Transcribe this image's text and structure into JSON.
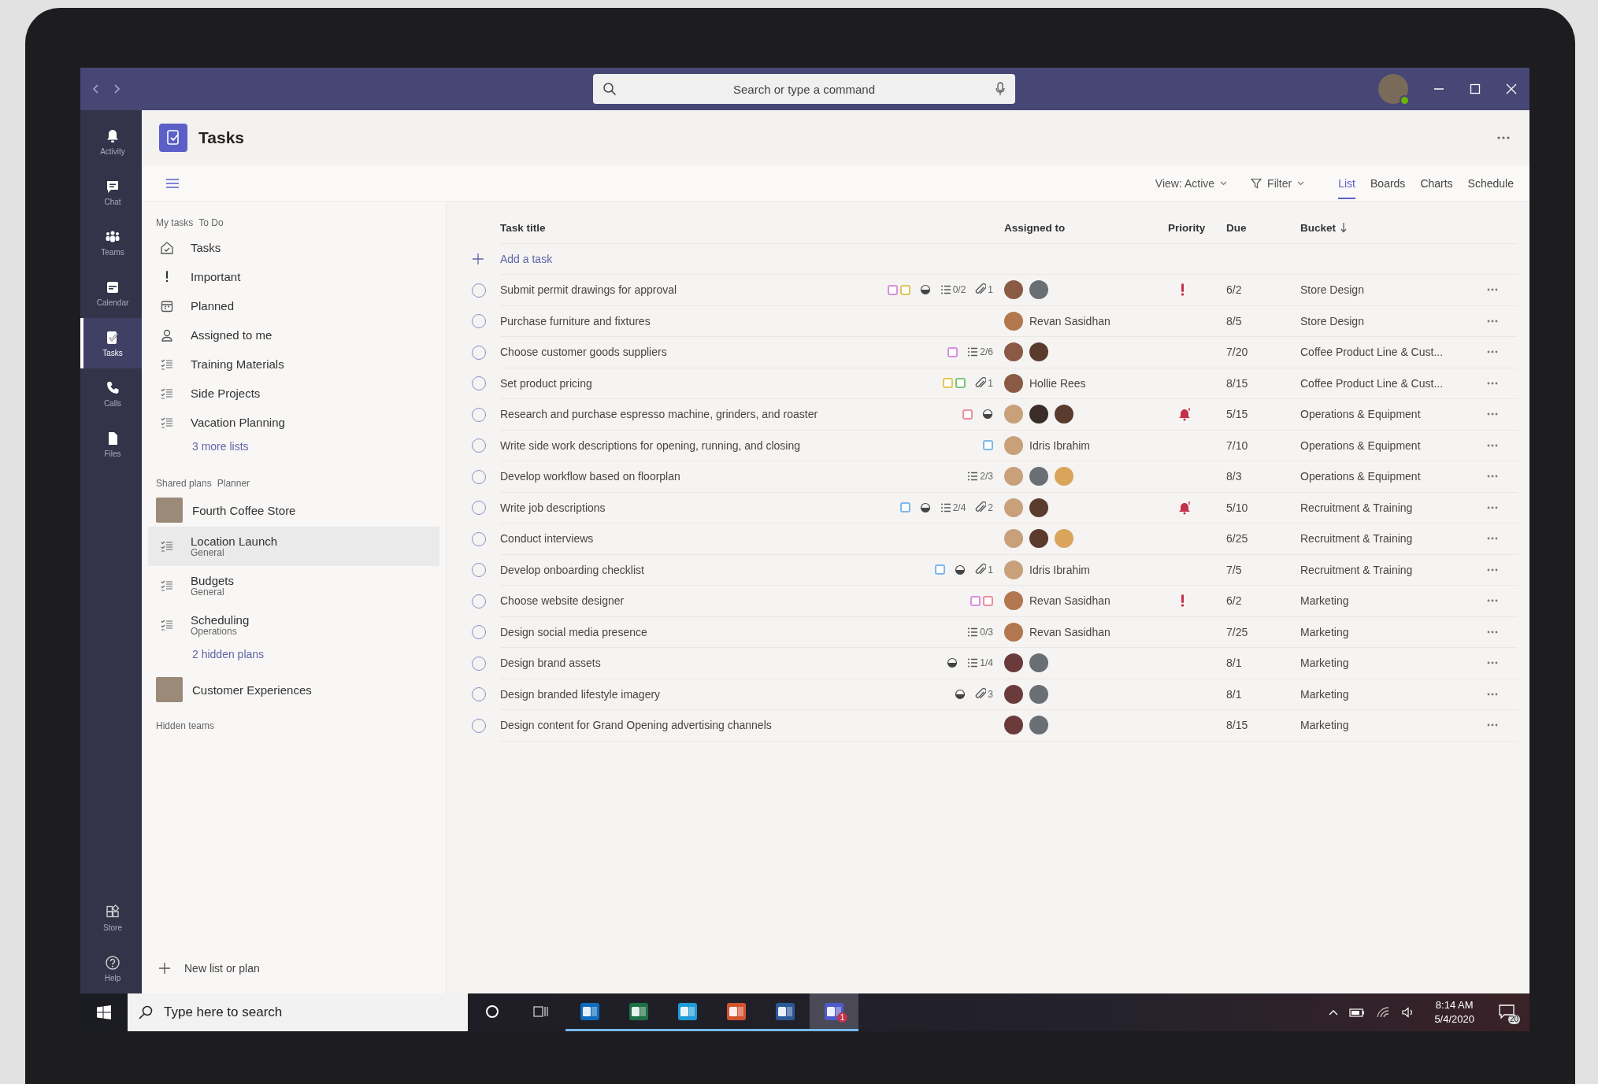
{
  "titlebar": {
    "search_placeholder": "Search or type a command"
  },
  "rail": {
    "items": [
      {
        "label": "Activity",
        "kind": "bell",
        "selected": false
      },
      {
        "label": "Chat",
        "kind": "chat",
        "selected": false
      },
      {
        "label": "Teams",
        "kind": "teams",
        "selected": false
      },
      {
        "label": "Calendar",
        "kind": "calendar",
        "selected": false
      },
      {
        "label": "Tasks",
        "kind": "tasks",
        "selected": true
      },
      {
        "label": "Calls",
        "kind": "calls",
        "selected": false
      },
      {
        "label": "Files",
        "kind": "files",
        "selected": false
      }
    ],
    "bottom_items": [
      {
        "label": "Store",
        "kind": "store",
        "selected": false
      },
      {
        "label": "Help",
        "kind": "help",
        "selected": false
      }
    ]
  },
  "app": {
    "title": "Tasks"
  },
  "toolbar": {
    "view": "View: Active",
    "filter": "Filter",
    "tabs": [
      {
        "label": "List",
        "selected": true
      },
      {
        "label": "Boards",
        "selected": false
      },
      {
        "label": "Charts",
        "selected": false
      },
      {
        "label": "Schedule",
        "selected": false
      }
    ]
  },
  "nav": {
    "my_tasks": {
      "heading": "My tasks",
      "source": "To Do",
      "items": [
        {
          "label": "Tasks",
          "kind": "home"
        },
        {
          "label": "Important",
          "kind": "important"
        },
        {
          "label": "Planned",
          "kind": "calendar"
        },
        {
          "label": "Assigned to me",
          "kind": "person"
        },
        {
          "label": "Training Materials",
          "kind": "list"
        },
        {
          "label": "Side Projects",
          "kind": "list"
        },
        {
          "label": "Vacation Planning",
          "kind": "list"
        }
      ],
      "more": "3 more lists"
    },
    "shared": {
      "heading": "Shared plans",
      "source": "Planner",
      "teams": [
        {
          "name": "Fourth Coffee Store",
          "children": [
            {
              "name": "Location Launch",
              "channel": "General",
              "selected": true
            },
            {
              "name": "Budgets",
              "channel": "General",
              "selected": false
            },
            {
              "name": "Scheduling",
              "channel": "Operations",
              "selected": false
            }
          ],
          "more": "2 hidden plans"
        },
        {
          "name": "Customer Experiences"
        }
      ]
    },
    "hidden_teams": "Hidden teams",
    "new": "New list or plan"
  },
  "table": {
    "columns": [
      {
        "label": "Task title",
        "sorted": false
      },
      {
        "label": "Assigned to",
        "sorted": false
      },
      {
        "label": "Priority",
        "sorted": false
      },
      {
        "label": "Due",
        "sorted": false
      },
      {
        "label": "Bucket",
        "sorted": true
      }
    ],
    "add": "Add a task",
    "rows": [
      {
        "title": "Submit permit drawings for approval",
        "completed": false,
        "labels": [
          {
            "color": "#d98fe0"
          },
          {
            "color": "#e2c65a"
          }
        ],
        "in_progress": true,
        "checklist": "0/2",
        "attachments": "1",
        "assignees": [
          {
            "color": "#8a5a44"
          },
          {
            "color": "#6a6e75"
          }
        ],
        "important": true,
        "urgent": false,
        "due": "6/2",
        "bucket": "Store Design"
      },
      {
        "title": "Purchase furniture and fixtures",
        "completed": false,
        "in_progress": false,
        "important": false,
        "urgent": false,
        "assignees": [
          {
            "color": "#b3774f"
          }
        ],
        "assignee_name": "Revan Sasidhan",
        "due": "8/5",
        "bucket": "Store Design"
      },
      {
        "title": "Choose customer goods suppliers",
        "completed": false,
        "in_progress": false,
        "important": false,
        "urgent": false,
        "labels": [
          {
            "color": "#d98fe0"
          }
        ],
        "checklist": "2/6",
        "assignees": [
          {
            "color": "#8a5a44"
          },
          {
            "color": "#5a3b2e"
          }
        ],
        "due": "7/20",
        "bucket": "Coffee Product Line & Cust..."
      },
      {
        "title": "Set product pricing",
        "completed": false,
        "in_progress": false,
        "important": false,
        "urgent": false,
        "labels": [
          {
            "color": "#e2c65a"
          },
          {
            "color": "#7cc47c"
          }
        ],
        "attachments": "1",
        "assignees": [
          {
            "color": "#8a5a44"
          }
        ],
        "assignee_name": "Hollie Rees",
        "due": "8/15",
        "bucket": "Coffee Product Line & Cust..."
      },
      {
        "title": "Research and purchase espresso machine, grinders, and roaster",
        "completed": false,
        "labels": [
          {
            "color": "#ee8f9c"
          }
        ],
        "in_progress": true,
        "assignees": [
          {
            "color": "#c8a07a"
          },
          {
            "color": "#3a2c28"
          },
          {
            "color": "#5a3b2e"
          }
        ],
        "important": false,
        "urgent": true,
        "due": "5/15",
        "bucket": "Operations & Equipment"
      },
      {
        "title": "Write side work descriptions for opening, running, and closing",
        "completed": false,
        "in_progress": false,
        "important": false,
        "urgent": false,
        "labels": [
          {
            "color": "#7fb8ea"
          }
        ],
        "assignees": [
          {
            "color": "#c8a07a"
          }
        ],
        "assignee_name": "Idris Ibrahim",
        "due": "7/10",
        "bucket": "Operations & Equipment"
      },
      {
        "title": "Develop workflow based on floorplan",
        "completed": false,
        "in_progress": false,
        "important": false,
        "urgent": false,
        "checklist": "2/3",
        "assignees": [
          {
            "color": "#c8a07a"
          },
          {
            "color": "#6a6e75"
          },
          {
            "color": "#d9a55c"
          }
        ],
        "due": "8/3",
        "bucket": "Operations & Equipment"
      },
      {
        "title": "Write job descriptions",
        "completed": false,
        "labels": [
          {
            "color": "#7fb8ea"
          }
        ],
        "in_progress": true,
        "checklist": "2/4",
        "attachments": "2",
        "assignees": [
          {
            "color": "#c8a07a"
          },
          {
            "color": "#5a3b2e"
          }
        ],
        "important": false,
        "urgent": true,
        "due": "5/10",
        "bucket": "Recruitment & Training"
      },
      {
        "title": "Conduct interviews",
        "completed": false,
        "in_progress": false,
        "important": false,
        "urgent": false,
        "assignees": [
          {
            "color": "#c8a07a"
          },
          {
            "color": "#5a3b2e"
          },
          {
            "color": "#d9a55c"
          }
        ],
        "due": "6/25",
        "bucket": "Recruitment & Training"
      },
      {
        "title": "Develop onboarding checklist",
        "completed": false,
        "labels": [
          {
            "color": "#7fb8ea"
          }
        ],
        "in_progress": true,
        "important": false,
        "urgent": false,
        "attachments": "1",
        "assignees": [
          {
            "color": "#c8a07a"
          }
        ],
        "assignee_name": "Idris Ibrahim",
        "due": "7/5",
        "bucket": "Recruitment & Training"
      },
      {
        "title": "Choose website designer",
        "completed": false,
        "labels": [
          {
            "color": "#d98fe0"
          },
          {
            "color": "#ee8f9c"
          }
        ],
        "assignees": [
          {
            "color": "#b3774f"
          }
        ],
        "assignee_name": "Revan Sasidhan",
        "in_progress": false,
        "important": true,
        "urgent": false,
        "due": "6/2",
        "bucket": "Marketing"
      },
      {
        "title": "Design social media presence",
        "completed": false,
        "in_progress": false,
        "important": false,
        "urgent": false,
        "checklist": "0/3",
        "assignees": [
          {
            "color": "#b3774f"
          }
        ],
        "assignee_name": "Revan Sasidhan",
        "due": "7/25",
        "bucket": "Marketing"
      },
      {
        "title": "Design brand assets",
        "completed": false,
        "in_progress": true,
        "important": false,
        "urgent": false,
        "checklist": "1/4",
        "assignees": [
          {
            "color": "#6b3b3b"
          },
          {
            "color": "#6a6e75"
          }
        ],
        "due": "8/1",
        "bucket": "Marketing"
      },
      {
        "title": "Design branded lifestyle imagery",
        "completed": false,
        "in_progress": true,
        "important": false,
        "urgent": false,
        "attachments": "3",
        "assignees": [
          {
            "color": "#6b3b3b"
          },
          {
            "color": "#6a6e75"
          }
        ],
        "due": "8/1",
        "bucket": "Marketing"
      },
      {
        "title": "Design content for Grand Opening advertising channels",
        "completed": false,
        "in_progress": false,
        "important": false,
        "urgent": false,
        "assignees": [
          {
            "color": "#6b3b3b"
          },
          {
            "color": "#6a6e75"
          }
        ],
        "due": "8/15",
        "bucket": "Marketing"
      }
    ]
  },
  "taskbar": {
    "search_placeholder": "Type here to search",
    "apps": [
      {
        "kind": "outlook",
        "running": true,
        "selected": false
      },
      {
        "kind": "excel",
        "running": true,
        "selected": false
      },
      {
        "kind": "edge",
        "running": true,
        "selected": false
      },
      {
        "kind": "powerpoint",
        "running": true,
        "selected": false
      },
      {
        "kind": "word",
        "running": true,
        "selected": false
      },
      {
        "kind": "teams",
        "running": true,
        "selected": true,
        "badge": "1"
      }
    ],
    "time": "8:14 AM",
    "date": "5/4/2020",
    "notifications": "20"
  }
}
